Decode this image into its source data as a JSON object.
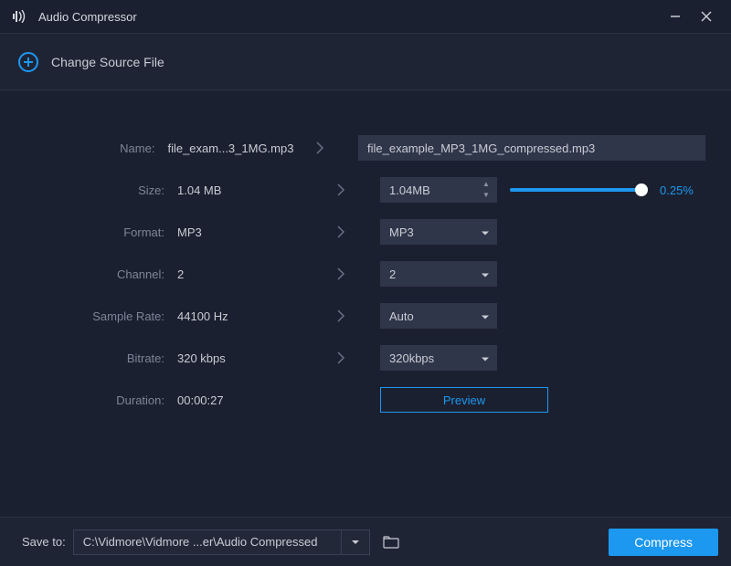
{
  "app": {
    "title": "Audio Compressor"
  },
  "source": {
    "change_label": "Change Source File"
  },
  "labels": {
    "name": "Name:",
    "size": "Size:",
    "format": "Format:",
    "channel": "Channel:",
    "sample_rate": "Sample Rate:",
    "bitrate": "Bitrate:",
    "duration": "Duration:"
  },
  "values": {
    "name": "file_exam...3_1MG.mp3",
    "size": "1.04 MB",
    "format": "MP3",
    "channel": "2",
    "sample_rate": "44100 Hz",
    "bitrate": "320 kbps",
    "duration": "00:00:27"
  },
  "controls": {
    "name_out": "file_example_MP3_1MG_compressed.mp3",
    "size_out": "1.04MB",
    "size_pct": "0.25%",
    "format_sel": "MP3",
    "channel_sel": "2",
    "sample_rate_sel": "Auto",
    "bitrate_sel": "320kbps",
    "preview": "Preview"
  },
  "footer": {
    "save_to_label": "Save to:",
    "path": "C:\\Vidmore\\Vidmore ...er\\Audio Compressed",
    "compress": "Compress"
  },
  "colors": {
    "accent": "#1c98f0"
  }
}
